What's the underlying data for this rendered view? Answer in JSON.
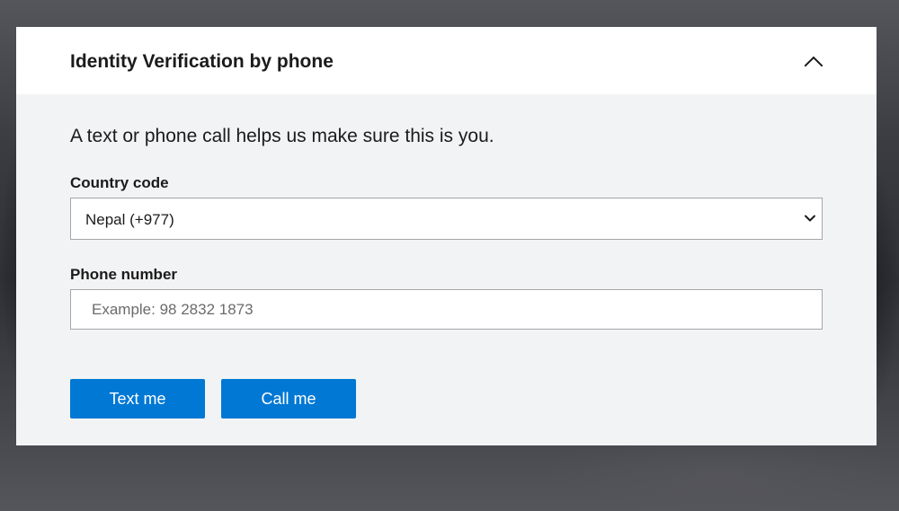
{
  "dialog": {
    "title": "Identity Verification by phone",
    "collapse_icon": "chevron-up-icon",
    "intro": "A text or phone call helps us make sure this is you."
  },
  "country_code": {
    "label": "Country code",
    "selected": "Nepal (+977)",
    "icon": "chevron-down-icon"
  },
  "phone_number": {
    "label": "Phone number",
    "value": "",
    "placeholder": "Example: 98 2832 1873"
  },
  "actions": {
    "text_me_label": "Text me",
    "call_me_label": "Call me"
  },
  "colors": {
    "accent": "#0078d4",
    "panel_background": "#f2f3f4",
    "header_background": "#ffffff",
    "text": "#1b1b1b"
  }
}
